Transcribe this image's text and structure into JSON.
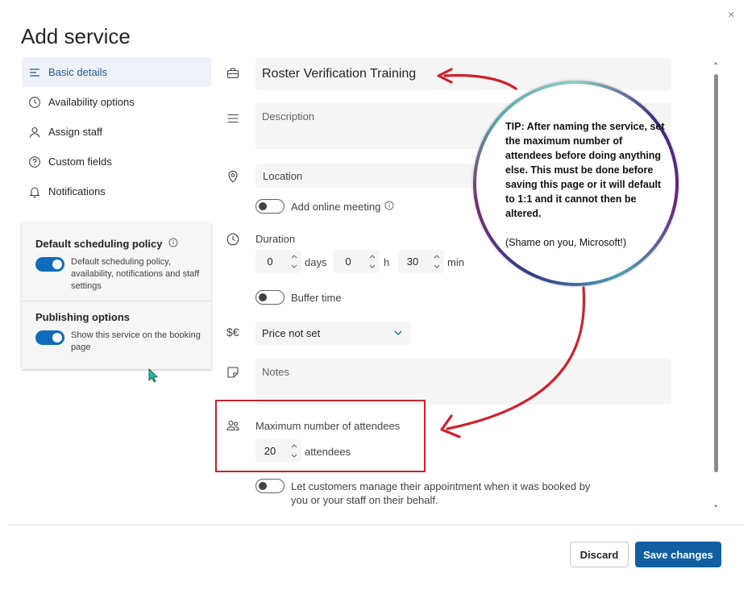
{
  "dialog": {
    "title": "Add service",
    "close_glyph": "×"
  },
  "nav": {
    "items": [
      {
        "label": "Basic details",
        "icon": "lines-icon",
        "active": true
      },
      {
        "label": "Availability options",
        "icon": "clock-icon",
        "active": false
      },
      {
        "label": "Assign staff",
        "icon": "person-icon",
        "active": false
      },
      {
        "label": "Custom fields",
        "icon": "question-circle-icon",
        "active": false
      },
      {
        "label": "Notifications",
        "icon": "bell-icon",
        "active": false
      }
    ]
  },
  "policy": {
    "default_title": "Default scheduling policy",
    "default_desc": "Default scheduling policy, availability, notifications and staff settings",
    "default_on": true,
    "publishing_title": "Publishing options",
    "publishing_desc": "Show this service on the booking page",
    "publishing_on": true
  },
  "form": {
    "service_name": "Roster Verification Training",
    "description_placeholder": "Description",
    "location_placeholder": "Location",
    "online_meeting_label": "Add online meeting",
    "duration_label": "Duration",
    "duration_days": "0",
    "duration_days_unit": "days",
    "duration_hours": "0",
    "duration_hours_unit": "h",
    "duration_minutes": "30",
    "duration_minutes_unit": "min",
    "buffer_label": "Buffer time",
    "price_value": "Price not set",
    "currency_symbol": "$€",
    "notes_placeholder": "Notes",
    "max_attendees_label": "Maximum number of attendees",
    "max_attendees_value": "20",
    "max_attendees_unit": "attendees",
    "manage_label": "Let customers manage their appointment when it was booked by you or your staff on their behalf."
  },
  "footer": {
    "discard_label": "Discard",
    "save_label": "Save changes"
  },
  "annotation": {
    "tip": "TIP: After naming the service, set the maximum number of attendees before doing anything else. This must be done before saving this page or it will default to 1:1 and it cannot then be altered.",
    "note": "(Shame on you, Microsoft!)",
    "arrow_color": "#d0202a",
    "highlight_color": "#c4252c"
  },
  "colors": {
    "accent": "#0f6cbd",
    "primary_button": "#115ea3",
    "active_nav_bg": "#eef2f8"
  }
}
